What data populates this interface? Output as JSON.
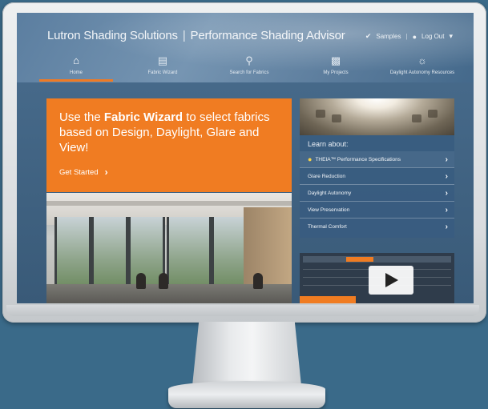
{
  "header": {
    "brand": "Lutron Shading Solutions",
    "separator": "|",
    "app_name": "Performance Shading Advisor",
    "samples_label": "Samples",
    "divider": "|",
    "logout_label": "Log Out"
  },
  "nav": {
    "items": [
      {
        "label": "Home",
        "icon": "home-icon"
      },
      {
        "label": "Fabric Wizard",
        "icon": "fabric-icon"
      },
      {
        "label": "Search for Fabrics",
        "icon": "search-icon"
      },
      {
        "label": "My Projects",
        "icon": "folder-icon"
      },
      {
        "label": "Daylight Autonomy Resources",
        "icon": "resources-icon"
      }
    ],
    "active_index": 0
  },
  "hero": {
    "text_before": "Use the ",
    "text_bold": "Fabric Wizard",
    "text_after": " to select fabrics based on Design, Daylight, Glare and View!",
    "cta": "Get Started"
  },
  "learn": {
    "title": "Learn about:",
    "items": [
      "THEIA™ Performance Specifications",
      "Glare Reduction",
      "Daylight Autonomy",
      "View Preservation",
      "Thermal Comfort"
    ]
  },
  "colors": {
    "accent": "#f07c22",
    "panel": "#385c80",
    "background": "#3a6a89"
  }
}
